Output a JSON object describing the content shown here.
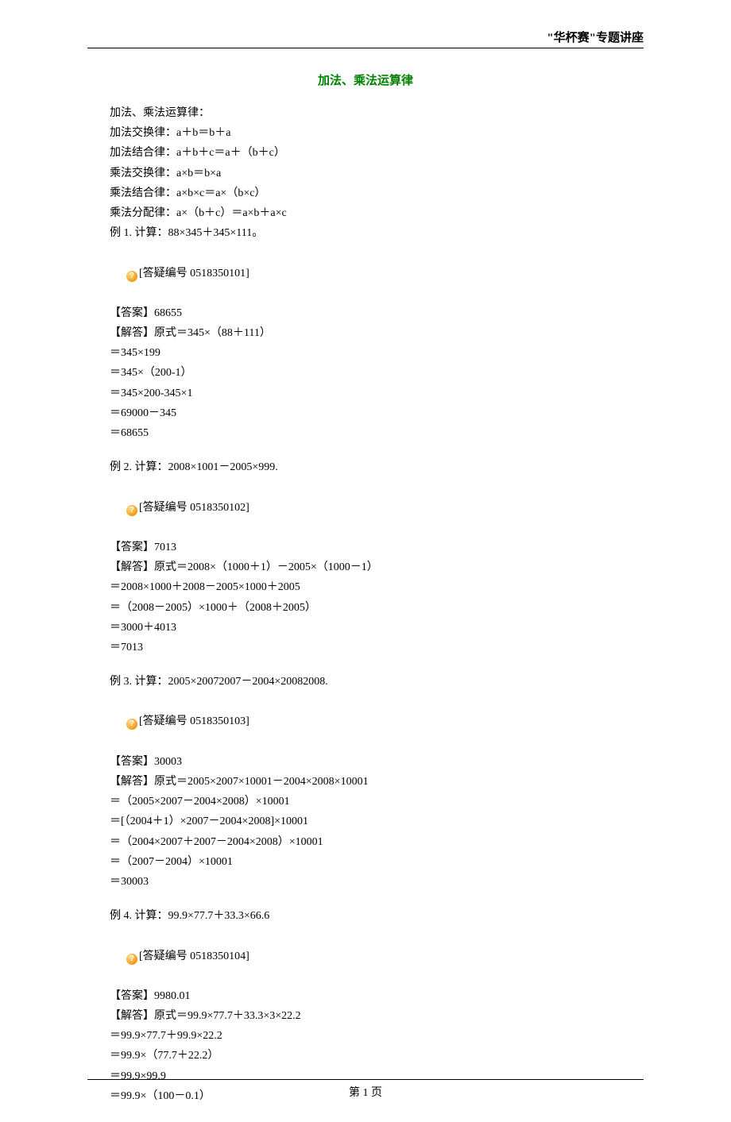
{
  "header": {
    "series_title": "\"华杯赛\"专题讲座"
  },
  "title": "加法、乘法运算律",
  "intro": {
    "heading": "加法、乘法运算律：",
    "laws": [
      "加法交换律：a＋b＝b＋a",
      "加法结合律：a＋b＋c＝a＋（b＋c）",
      "乘法交换律：a×b＝b×a",
      "乘法结合律：a×b×c＝a×（b×c）",
      "乘法分配律：a×（b＋c）＝a×b＋a×c"
    ]
  },
  "examples": [
    {
      "prompt": "例 1. 计算：88×345＋345×111。",
      "qa_id": "[答疑编号 0518350101]",
      "answer": "【答案】68655",
      "solution_head": "【解答】原式＝345×（88＋111）",
      "steps": [
        "＝345×199",
        "＝345×（200-1）",
        "＝345×200-345×1",
        "＝69000－345",
        "＝68655"
      ]
    },
    {
      "prompt": "例 2. 计算：2008×1001－2005×999.",
      "qa_id": "[答疑编号 0518350102]",
      "answer": "【答案】7013",
      "solution_head": "【解答】原式＝2008×（1000＋1）－2005×（1000－1）",
      "steps": [
        "＝2008×1000＋2008－2005×1000＋2005",
        "＝（2008－2005）×1000＋（2008＋2005）",
        "＝3000＋4013",
        "＝7013"
      ]
    },
    {
      "prompt": "例 3. 计算：2005×20072007－2004×20082008.",
      "qa_id": "[答疑编号 0518350103]",
      "answer": "【答案】30003",
      "solution_head": "【解答】原式＝2005×2007×10001－2004×2008×10001",
      "steps": [
        "＝（2005×2007－2004×2008）×10001",
        "＝[（2004＋1）×2007－2004×2008]×10001",
        "＝（2004×2007＋2007－2004×2008）×10001",
        "＝（2007－2004）×10001",
        "＝30003"
      ]
    },
    {
      "prompt": "例 4. 计算：99.9×77.7＋33.3×66.6",
      "qa_id": "[答疑编号 0518350104]",
      "answer": "【答案】9980.01",
      "solution_head": "【解答】原式＝99.9×77.7＋33.3×3×22.2",
      "steps": [
        "＝99.9×77.7＋99.9×22.2",
        "＝99.9×（77.7＋22.2）",
        "＝99.9×99.9",
        "＝99.9×（100－0.1）"
      ]
    }
  ],
  "qa_icon_glyph": "?",
  "footer": {
    "page_label": "第 1 页"
  }
}
